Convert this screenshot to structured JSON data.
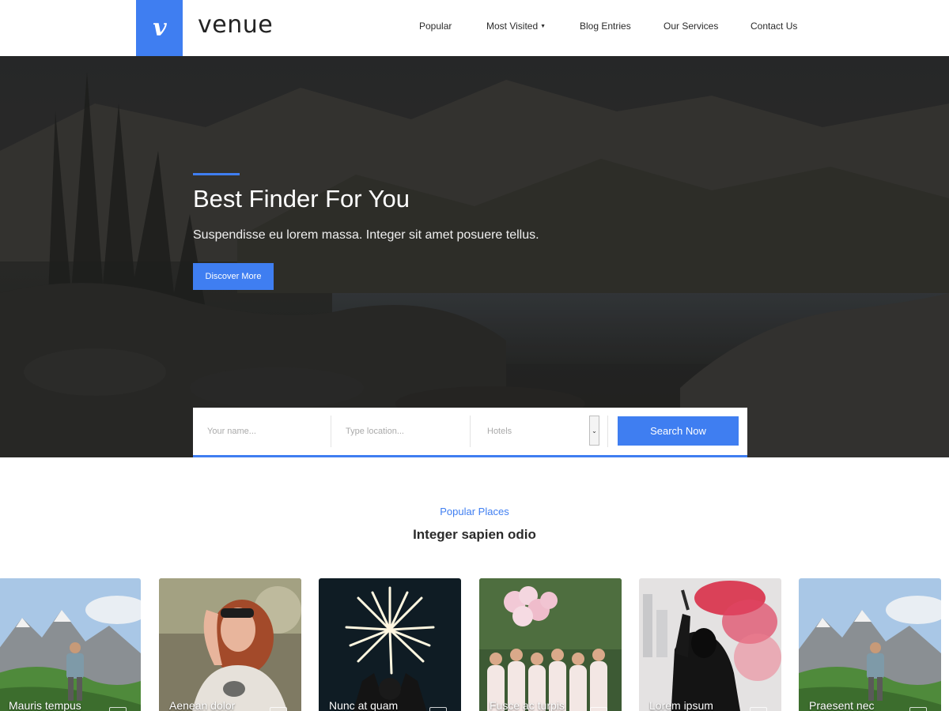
{
  "brand": {
    "name": "venue",
    "logo_letter": "v",
    "accent": "#3f7ef1"
  },
  "nav": {
    "items": [
      {
        "label": "Popular"
      },
      {
        "label": "Most Visited",
        "has_dropdown": true
      },
      {
        "label": "Blog Entries"
      },
      {
        "label": "Our Services"
      },
      {
        "label": "Contact Us"
      }
    ],
    "dropdown_icon": "caret-down-icon"
  },
  "hero": {
    "title": "Best Finder For You",
    "subtitle": "Suspendisse eu lorem massa. Integer sit amet posuere tellus.",
    "cta_label": "Discover More"
  },
  "search": {
    "name_placeholder": "Your name...",
    "location_placeholder": "Type location...",
    "category_selected": "Hotels",
    "button_label": "Search Now",
    "select_icon": "chevron-down-icon"
  },
  "popular": {
    "kicker": "Popular Places",
    "title": "Integer sapien odio",
    "places": [
      {
        "name": "Mauris tempus",
        "image": "mountain-hiker"
      },
      {
        "name": "Aenean dolor",
        "image": "smiling-woman"
      },
      {
        "name": "Nunc at quam",
        "image": "fireworks"
      },
      {
        "name": "Fusce ac turpis",
        "image": "bridesmaids-balloons"
      },
      {
        "name": "Lorem ipsum",
        "image": "red-smoke-flare"
      },
      {
        "name": "Praesent nec",
        "image": "mountain-hiker"
      }
    ]
  }
}
